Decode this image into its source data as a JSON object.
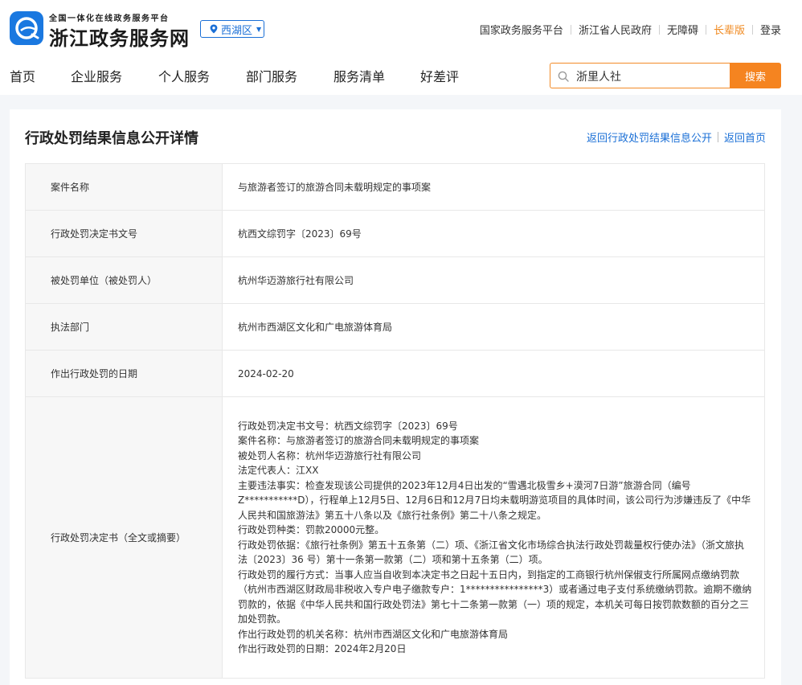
{
  "header": {
    "brand_sub": "全国一体化在线政务服务平台",
    "brand_main": "浙江政务服务网",
    "region": "西湖区",
    "top_links": [
      "国家政务服务平台",
      "浙江省人民政府",
      "无障碍",
      "长辈版",
      "登录"
    ],
    "accent_orange": "#f08a21",
    "brand_blue": "#1a6fd6"
  },
  "nav": {
    "items": [
      "首页",
      "企业服务",
      "个人服务",
      "部门服务",
      "服务清单",
      "好差评"
    ]
  },
  "search": {
    "value": "浙里人社",
    "button": "搜索",
    "icon": "search-icon"
  },
  "page": {
    "title": "行政处罚结果信息公开详情",
    "links": [
      "返回行政处罚结果信息公开",
      "返回首页"
    ]
  },
  "details": {
    "rows": [
      {
        "label": "案件名称",
        "value": "与旅游者签订的旅游合同未载明规定的事项案"
      },
      {
        "label": "行政处罚决定书文号",
        "value": "杭西文综罚字〔2023〕69号"
      },
      {
        "label": "被处罚单位（被处罚人）",
        "value": "杭州华迈游旅行社有限公司"
      },
      {
        "label": "执法部门",
        "value": "杭州市西湖区文化和广电旅游体育局"
      },
      {
        "label": "作出行政处罚的日期",
        "value": "2024-02-20"
      }
    ],
    "decision_label": "行政处罚决定书（全文或摘要）",
    "decision_lines": [
      "行政处罚决定书文号：杭西文综罚字〔2023〕69号",
      "案件名称：与旅游者签订的旅游合同未载明规定的事项案",
      "被处罚人名称：杭州华迈游旅行社有限公司",
      "法定代表人：江XX",
      "主要违法事实：检查发现该公司提供的2023年12月4日出发的“雪遇北极雪乡+漠河7日游”旅游合同（编号Z***********D），行程单上12月5日、12月6日和12月7日均未载明游览项目的具体时间，该公司行为涉嫌违反了《中华人民共和国旅游法》第五十八条以及《旅行社条例》第二十八条之规定。",
      "行政处罚种类：罚款20000元整。",
      "行政处罚依据：《旅行社条例》第五十五条第（二）项、《浙江省文化市场综合执法行政处罚裁量权行使办法》（浙文旅执法〔2023〕36 号）第十一条第一款第（二）项和第十五条第（二）项。",
      "行政处罚的履行方式：当事人应当自收到本决定书之日起十五日内，到指定的工商银行杭州保俶支行所属网点缴纳罚款（杭州市西湖区财政局非税收入专户电子缴款专户：1****************3）或者通过电子支付系统缴纳罚款。逾期不缴纳罚款的，依据《中华人民共和国行政处罚法》第七十二条第一款第（一）项的规定，本机关可每日按罚款数额的百分之三加处罚款。",
      "作出行政处罚的机关名称：杭州市西湖区文化和广电旅游体育局",
      "作出行政处罚的日期：2024年2月20日"
    ]
  }
}
